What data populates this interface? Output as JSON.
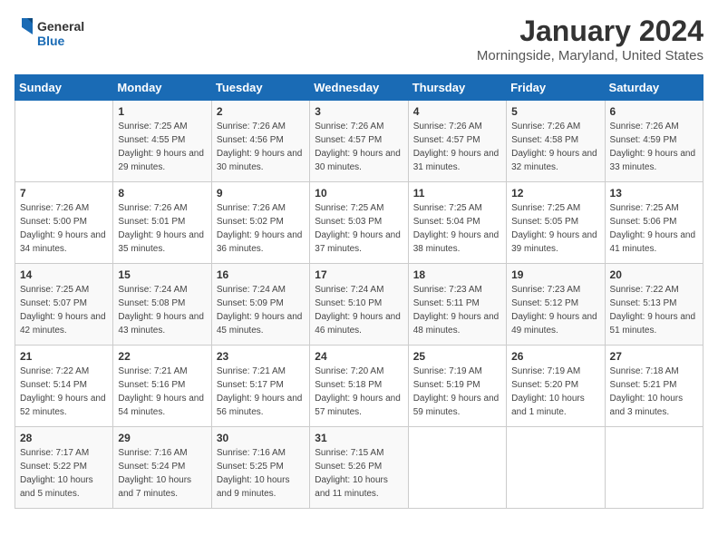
{
  "logo": {
    "text_general": "General",
    "text_blue": "Blue"
  },
  "header": {
    "month": "January 2024",
    "location": "Morningside, Maryland, United States"
  },
  "weekdays": [
    "Sunday",
    "Monday",
    "Tuesday",
    "Wednesday",
    "Thursday",
    "Friday",
    "Saturday"
  ],
  "weeks": [
    [
      {
        "day": "",
        "sunrise": "",
        "sunset": "",
        "daylight": ""
      },
      {
        "day": "1",
        "sunrise": "Sunrise: 7:25 AM",
        "sunset": "Sunset: 4:55 PM",
        "daylight": "Daylight: 9 hours and 29 minutes."
      },
      {
        "day": "2",
        "sunrise": "Sunrise: 7:26 AM",
        "sunset": "Sunset: 4:56 PM",
        "daylight": "Daylight: 9 hours and 30 minutes."
      },
      {
        "day": "3",
        "sunrise": "Sunrise: 7:26 AM",
        "sunset": "Sunset: 4:57 PM",
        "daylight": "Daylight: 9 hours and 30 minutes."
      },
      {
        "day": "4",
        "sunrise": "Sunrise: 7:26 AM",
        "sunset": "Sunset: 4:57 PM",
        "daylight": "Daylight: 9 hours and 31 minutes."
      },
      {
        "day": "5",
        "sunrise": "Sunrise: 7:26 AM",
        "sunset": "Sunset: 4:58 PM",
        "daylight": "Daylight: 9 hours and 32 minutes."
      },
      {
        "day": "6",
        "sunrise": "Sunrise: 7:26 AM",
        "sunset": "Sunset: 4:59 PM",
        "daylight": "Daylight: 9 hours and 33 minutes."
      }
    ],
    [
      {
        "day": "7",
        "sunrise": "Sunrise: 7:26 AM",
        "sunset": "Sunset: 5:00 PM",
        "daylight": "Daylight: 9 hours and 34 minutes."
      },
      {
        "day": "8",
        "sunrise": "Sunrise: 7:26 AM",
        "sunset": "Sunset: 5:01 PM",
        "daylight": "Daylight: 9 hours and 35 minutes."
      },
      {
        "day": "9",
        "sunrise": "Sunrise: 7:26 AM",
        "sunset": "Sunset: 5:02 PM",
        "daylight": "Daylight: 9 hours and 36 minutes."
      },
      {
        "day": "10",
        "sunrise": "Sunrise: 7:25 AM",
        "sunset": "Sunset: 5:03 PM",
        "daylight": "Daylight: 9 hours and 37 minutes."
      },
      {
        "day": "11",
        "sunrise": "Sunrise: 7:25 AM",
        "sunset": "Sunset: 5:04 PM",
        "daylight": "Daylight: 9 hours and 38 minutes."
      },
      {
        "day": "12",
        "sunrise": "Sunrise: 7:25 AM",
        "sunset": "Sunset: 5:05 PM",
        "daylight": "Daylight: 9 hours and 39 minutes."
      },
      {
        "day": "13",
        "sunrise": "Sunrise: 7:25 AM",
        "sunset": "Sunset: 5:06 PM",
        "daylight": "Daylight: 9 hours and 41 minutes."
      }
    ],
    [
      {
        "day": "14",
        "sunrise": "Sunrise: 7:25 AM",
        "sunset": "Sunset: 5:07 PM",
        "daylight": "Daylight: 9 hours and 42 minutes."
      },
      {
        "day": "15",
        "sunrise": "Sunrise: 7:24 AM",
        "sunset": "Sunset: 5:08 PM",
        "daylight": "Daylight: 9 hours and 43 minutes."
      },
      {
        "day": "16",
        "sunrise": "Sunrise: 7:24 AM",
        "sunset": "Sunset: 5:09 PM",
        "daylight": "Daylight: 9 hours and 45 minutes."
      },
      {
        "day": "17",
        "sunrise": "Sunrise: 7:24 AM",
        "sunset": "Sunset: 5:10 PM",
        "daylight": "Daylight: 9 hours and 46 minutes."
      },
      {
        "day": "18",
        "sunrise": "Sunrise: 7:23 AM",
        "sunset": "Sunset: 5:11 PM",
        "daylight": "Daylight: 9 hours and 48 minutes."
      },
      {
        "day": "19",
        "sunrise": "Sunrise: 7:23 AM",
        "sunset": "Sunset: 5:12 PM",
        "daylight": "Daylight: 9 hours and 49 minutes."
      },
      {
        "day": "20",
        "sunrise": "Sunrise: 7:22 AM",
        "sunset": "Sunset: 5:13 PM",
        "daylight": "Daylight: 9 hours and 51 minutes."
      }
    ],
    [
      {
        "day": "21",
        "sunrise": "Sunrise: 7:22 AM",
        "sunset": "Sunset: 5:14 PM",
        "daylight": "Daylight: 9 hours and 52 minutes."
      },
      {
        "day": "22",
        "sunrise": "Sunrise: 7:21 AM",
        "sunset": "Sunset: 5:16 PM",
        "daylight": "Daylight: 9 hours and 54 minutes."
      },
      {
        "day": "23",
        "sunrise": "Sunrise: 7:21 AM",
        "sunset": "Sunset: 5:17 PM",
        "daylight": "Daylight: 9 hours and 56 minutes."
      },
      {
        "day": "24",
        "sunrise": "Sunrise: 7:20 AM",
        "sunset": "Sunset: 5:18 PM",
        "daylight": "Daylight: 9 hours and 57 minutes."
      },
      {
        "day": "25",
        "sunrise": "Sunrise: 7:19 AM",
        "sunset": "Sunset: 5:19 PM",
        "daylight": "Daylight: 9 hours and 59 minutes."
      },
      {
        "day": "26",
        "sunrise": "Sunrise: 7:19 AM",
        "sunset": "Sunset: 5:20 PM",
        "daylight": "Daylight: 10 hours and 1 minute."
      },
      {
        "day": "27",
        "sunrise": "Sunrise: 7:18 AM",
        "sunset": "Sunset: 5:21 PM",
        "daylight": "Daylight: 10 hours and 3 minutes."
      }
    ],
    [
      {
        "day": "28",
        "sunrise": "Sunrise: 7:17 AM",
        "sunset": "Sunset: 5:22 PM",
        "daylight": "Daylight: 10 hours and 5 minutes."
      },
      {
        "day": "29",
        "sunrise": "Sunrise: 7:16 AM",
        "sunset": "Sunset: 5:24 PM",
        "daylight": "Daylight: 10 hours and 7 minutes."
      },
      {
        "day": "30",
        "sunrise": "Sunrise: 7:16 AM",
        "sunset": "Sunset: 5:25 PM",
        "daylight": "Daylight: 10 hours and 9 minutes."
      },
      {
        "day": "31",
        "sunrise": "Sunrise: 7:15 AM",
        "sunset": "Sunset: 5:26 PM",
        "daylight": "Daylight: 10 hours and 11 minutes."
      },
      {
        "day": "",
        "sunrise": "",
        "sunset": "",
        "daylight": ""
      },
      {
        "day": "",
        "sunrise": "",
        "sunset": "",
        "daylight": ""
      },
      {
        "day": "",
        "sunrise": "",
        "sunset": "",
        "daylight": ""
      }
    ]
  ]
}
